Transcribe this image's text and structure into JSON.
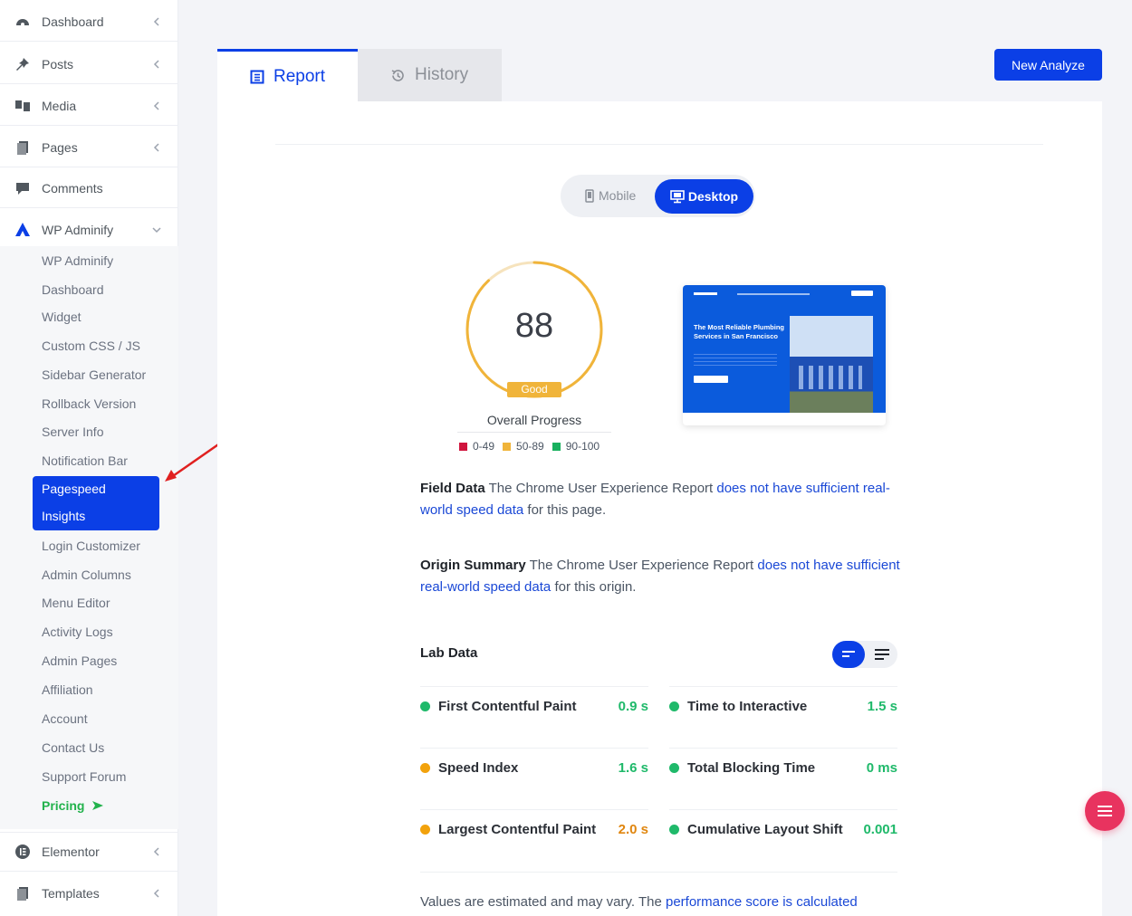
{
  "sidebar": {
    "top_items": [
      {
        "label": "Dashboard",
        "icon": "dashboard-icon"
      },
      {
        "label": "Posts",
        "icon": "pin-icon"
      },
      {
        "label": "Media",
        "icon": "media-icon"
      },
      {
        "label": "Pages",
        "icon": "pages-icon"
      },
      {
        "label": "Comments",
        "icon": "comments-icon"
      },
      {
        "label": "WP Adminify",
        "icon": "adminify-icon"
      }
    ],
    "sub_items": [
      "WP Adminify",
      "Dashboard",
      "Widget",
      "Custom CSS / JS",
      "Sidebar Generator",
      "Rollback Version",
      "Server Info",
      "Notification Bar"
    ],
    "active_sub": {
      "line1": "Pagespeed",
      "line2": "Insights"
    },
    "sub_items_after": [
      "Login Customizer",
      "Admin Columns",
      "Menu Editor",
      "Activity Logs",
      "Admin Pages",
      "Affiliation",
      "Account",
      "Contact Us",
      "Support Forum"
    ],
    "pricing": "Pricing",
    "bottom_items": [
      {
        "label": "Elementor",
        "icon": "elementor-icon"
      },
      {
        "label": "Templates",
        "icon": "templates-icon"
      }
    ]
  },
  "tabs": {
    "report": "Report",
    "history": "History"
  },
  "new_analyze": "New Analyze",
  "device_toggle": {
    "mobile": "Mobile",
    "desktop": "Desktop",
    "selected": "Desktop"
  },
  "score": {
    "value": "88",
    "fraction": 0.88,
    "rating": "Good",
    "label": "Overall Progress"
  },
  "legend": [
    {
      "range": "0-49",
      "color": "#d0143d"
    },
    {
      "range": "50-89",
      "color": "#f0b43a"
    },
    {
      "range": "90-100",
      "color": "#18b05e"
    }
  ],
  "thumbnail": {
    "headline": "The Most Reliable Plumbing Services in San Francisco"
  },
  "field_data": {
    "title": "Field Data",
    "text1": "The Chrome User Experience Report",
    "link": "does not have sufficient real-world speed data",
    "text2": "for this page."
  },
  "origin_summary": {
    "title": "Origin Summary",
    "text1": "The Chrome User Experience Report",
    "link": "does not have sufficient real-world speed data",
    "text2": "for this origin."
  },
  "lab_data": {
    "title": "Lab Data",
    "metrics": [
      {
        "name": "First Contentful Paint",
        "value": "0.9 s",
        "status": "green"
      },
      {
        "name": "Time to Interactive",
        "value": "1.5 s",
        "status": "green"
      },
      {
        "name": "Speed Index",
        "value": "1.6 s",
        "status": "orange"
      },
      {
        "name": "Total Blocking Time",
        "value": "0 ms",
        "status": "green"
      },
      {
        "name": "Largest Contentful Paint",
        "value": "2.0 s",
        "status": "orange"
      },
      {
        "name": "Cumulative Layout Shift",
        "value": "0.001",
        "status": "green"
      }
    ]
  },
  "footer_note": {
    "text": "Values are estimated and may vary. The",
    "link": "performance score is calculated"
  },
  "colors": {
    "accent": "#0b3fe6",
    "good": "#1fb96a",
    "average": "#e0860f",
    "fab": "#e8335f"
  }
}
